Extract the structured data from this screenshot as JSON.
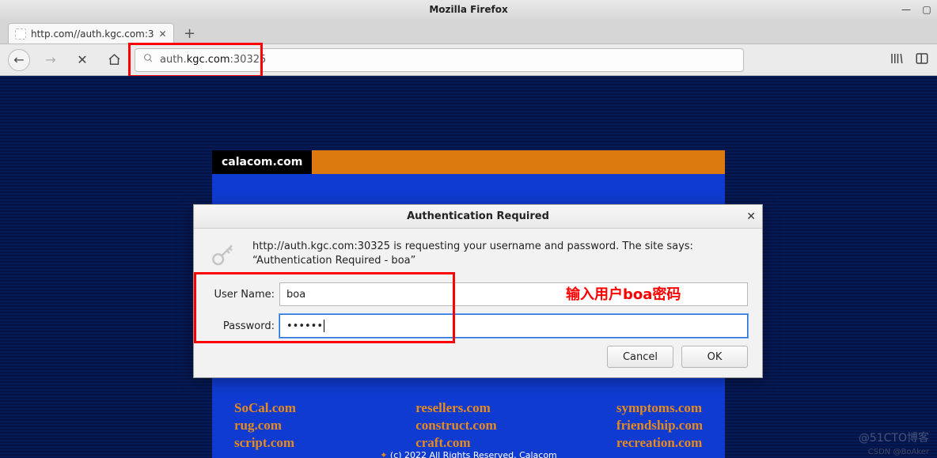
{
  "window": {
    "title": "Mozilla Firefox"
  },
  "tab": {
    "label": "http.com//auth.kgc.com:3"
  },
  "urlbar": {
    "scheme": "auth.",
    "host": "kgc.com",
    "port": ":30325"
  },
  "page": {
    "brand": "calacom.com",
    "columns": [
      [
        "SoCal.com",
        "rug.com",
        "script.com"
      ],
      [
        "resellers.com",
        "construct.com",
        "craft.com"
      ],
      [
        "symptoms.com",
        "friendship.com",
        "recreation.com"
      ]
    ],
    "footer": "(c) 2022 All Rights Reserved. Calacom"
  },
  "dialog": {
    "title": "Authentication Required",
    "message": "http://auth.kgc.com:30325 is requesting your username and password. The site says: “Authentication Required - boa”",
    "username_label": "User Name:",
    "username_value": "boa",
    "password_label": "Password:",
    "password_value": "••••••",
    "cancel": "Cancel",
    "ok": "OK"
  },
  "annotation": "输入用户boa密码",
  "watermarks": {
    "w1": "@51CTO博客",
    "w2": "CSDN @BoAker"
  }
}
